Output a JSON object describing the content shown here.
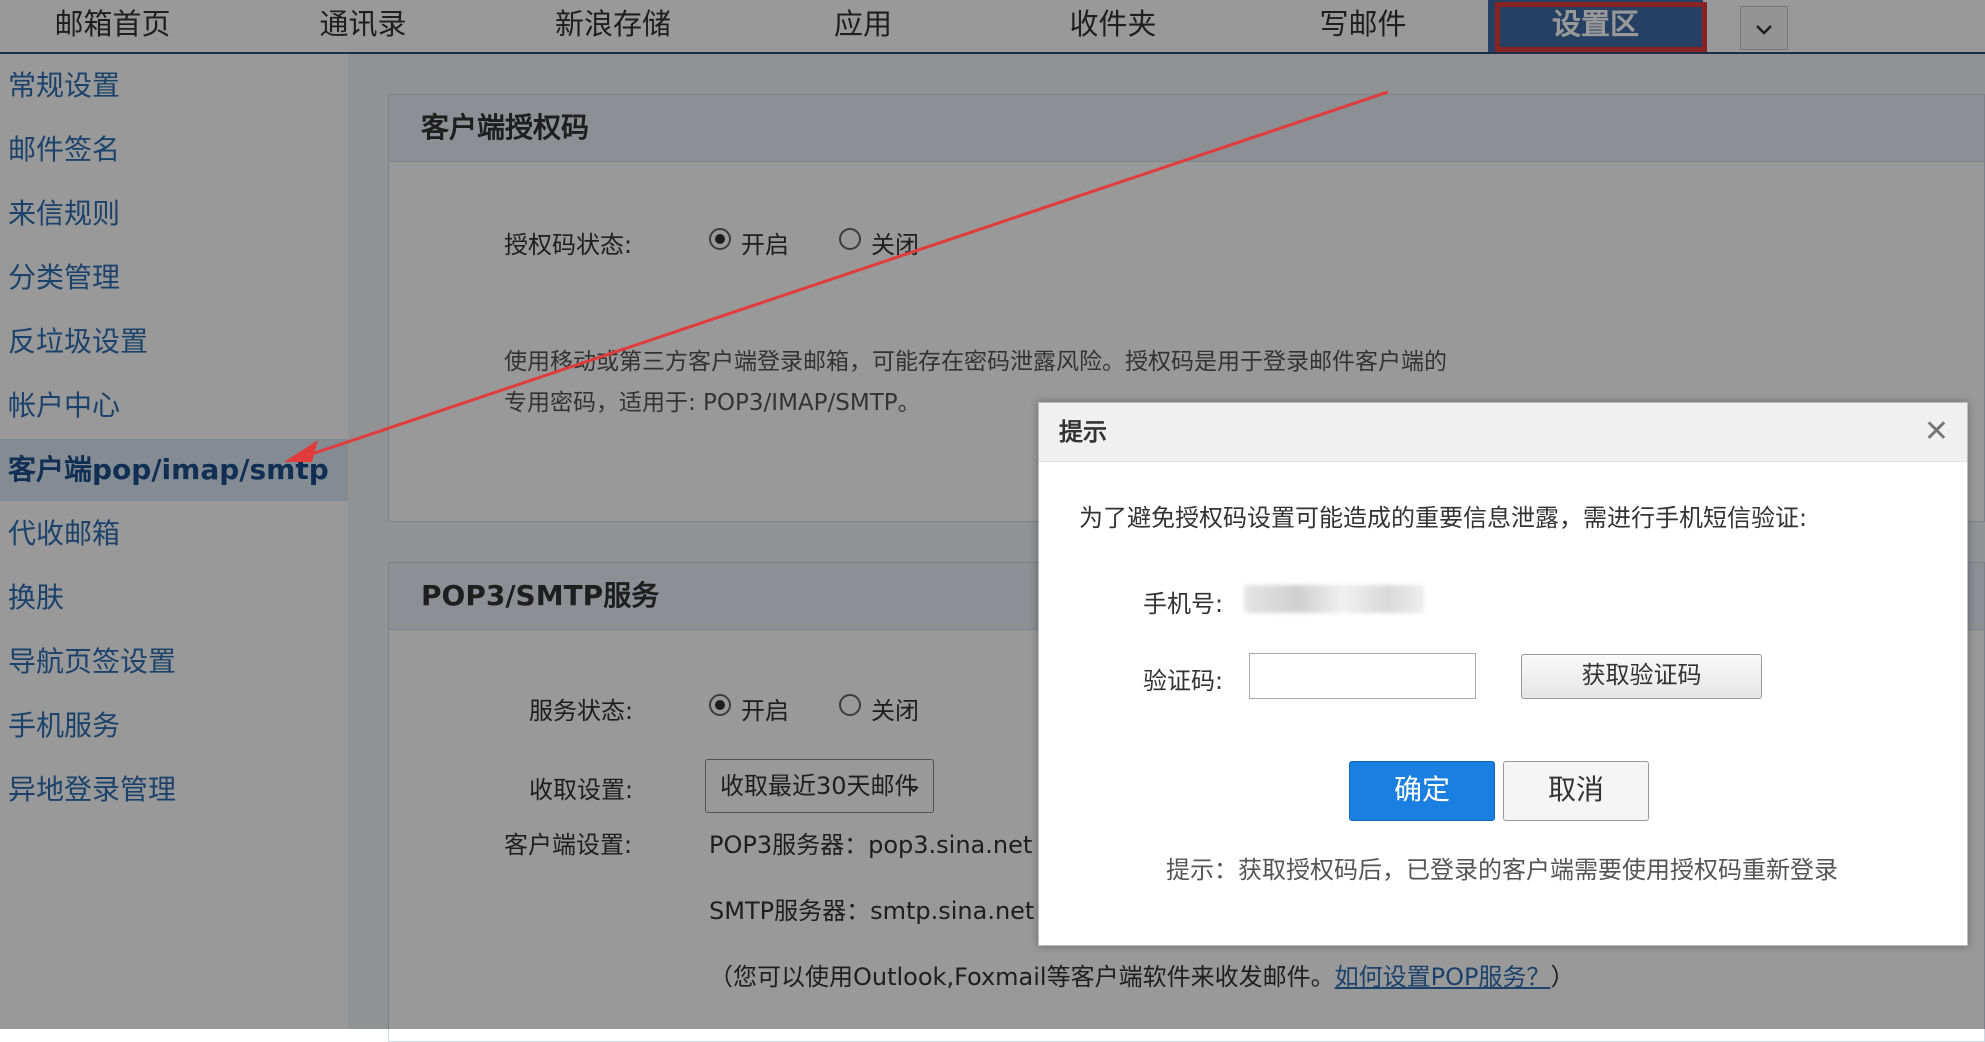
{
  "topnav": {
    "items": [
      "邮箱首页",
      "通讯录",
      "新浪存储",
      "应用",
      "收件夹",
      "写邮件",
      "设置区"
    ],
    "more_icon": "chevron-down-icon"
  },
  "sidebar": {
    "items": [
      "常规设置",
      "邮件签名",
      "来信规则",
      "分类管理",
      "反垃圾设置",
      "帐户中心",
      "客户端pop/imap/smtp",
      "代收邮箱",
      "换肤",
      "导航页签设置",
      "手机服务",
      "异地登录管理"
    ]
  },
  "auth_panel": {
    "title": "客户端授权码",
    "status_label": "授权码状态:",
    "on_label": "开启",
    "off_label": "关闭",
    "desc_line1": "使用移动或第三方客户端登录邮箱，可能存在密码泄露风险。授权码是用于登录邮件客户端的",
    "desc_line2": "专用密码，适用于: POP3/IMAP/SMTP。"
  },
  "pop_panel": {
    "title": "POP3/SMTP服务",
    "service_label": "服务状态:",
    "on_label": "开启",
    "off_label": "关闭",
    "fetch_label": "收取设置:",
    "fetch_value": "收取最近30天邮件",
    "client_label": "客户端设置:",
    "pop3_server": "POP3服务器：pop3.sina.net",
    "smtp_server": "SMTP服务器：smtp.sina.net",
    "note_prefix": "（您可以使用Outlook,Foxmail等客户端软件来收发邮件。",
    "note_link": "如何设置POP服务？",
    "note_suffix": "）"
  },
  "dialog": {
    "title": "提示",
    "close_icon": "close-icon",
    "message": "为了避免授权码设置可能造成的重要信息泄露，需进行手机短信验证:",
    "phone_label": "手机号:",
    "code_label": "验证码:",
    "code_value": "",
    "get_code_button": "获取验证码",
    "confirm_button": "确定",
    "cancel_button": "取消",
    "hint": "提示：获取授权码后，已登录的客户端需要使用授权码重新登录"
  },
  "colors": {
    "nav_active": "#3e6ba3",
    "annotation_red": "#e23b3b",
    "primary_button": "#1a7fe0",
    "link": "#2f6fb3"
  }
}
